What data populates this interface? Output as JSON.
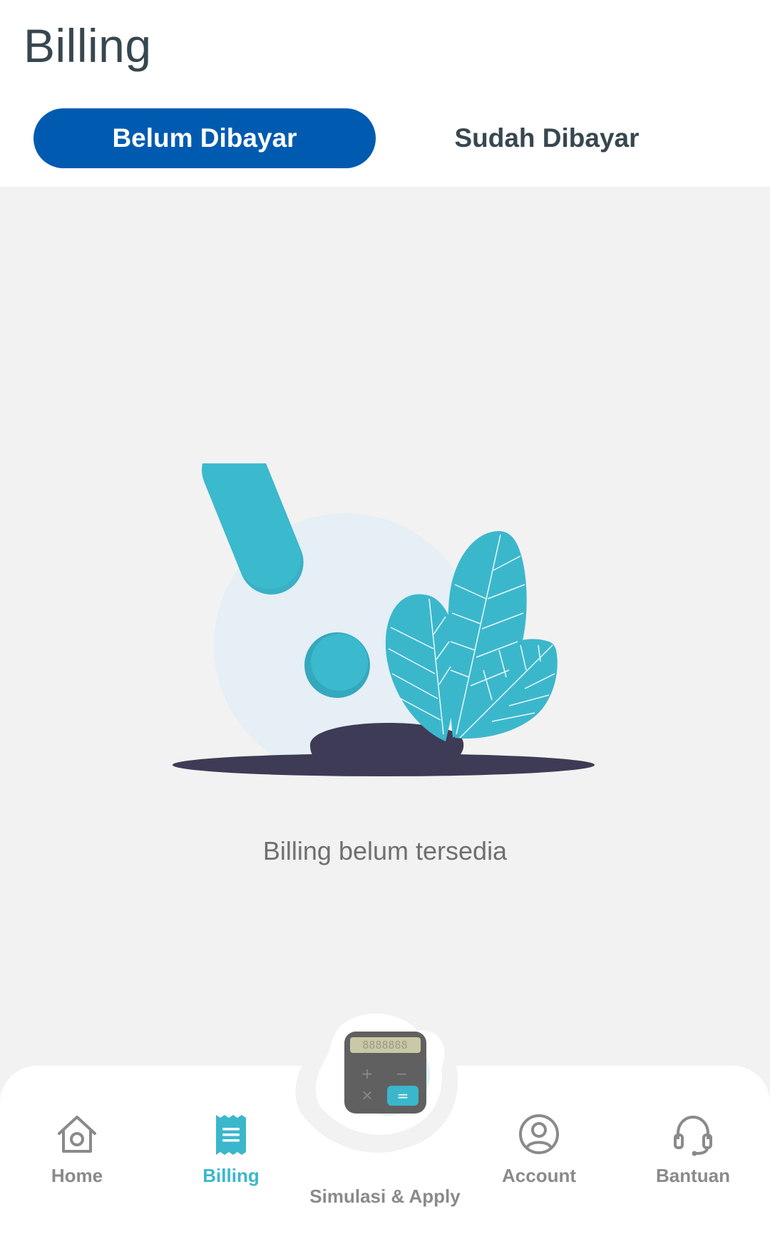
{
  "header": {
    "title": "Billing"
  },
  "tabs": [
    {
      "label": "Belum Dibayar",
      "active": true
    },
    {
      "label": "Sudah Dibayar",
      "active": false
    }
  ],
  "empty_state": {
    "illustration": "exclamation-with-leaves",
    "message": "Billing belum tersedia"
  },
  "bottom_nav": {
    "items": [
      {
        "label": "Home",
        "icon": "home-icon",
        "active": false
      },
      {
        "label": "Billing",
        "icon": "billing-receipt-icon",
        "active": true
      },
      {
        "label": "Simulasi & Apply",
        "icon": "calculator-icon",
        "active": false
      },
      {
        "label": "Account",
        "icon": "account-icon",
        "active": false
      },
      {
        "label": "Bantuan",
        "icon": "headset-icon",
        "active": false
      }
    ]
  },
  "colors": {
    "primary": "#005bb0",
    "accent": "#3bb7cc",
    "text_dark": "#37474f",
    "text_muted": "#8a8a8a",
    "background": "#f2f2f2"
  }
}
